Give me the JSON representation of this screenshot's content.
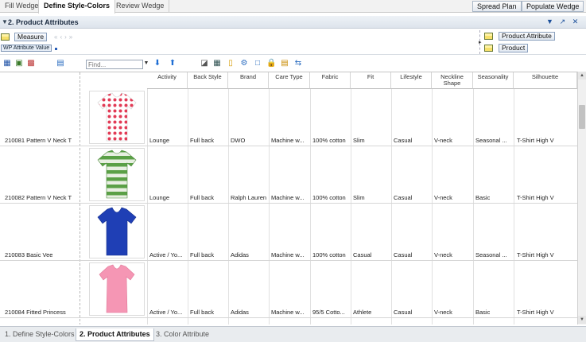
{
  "top_tabs": [
    "Fill Wedge",
    "Define Style-Colors",
    "Review Wedge"
  ],
  "top_buttons": {
    "spread_plan": "Spread Plan",
    "populate_wedge": "Populate Wedge"
  },
  "section": {
    "title": "2. Product Attributes"
  },
  "pivot": {
    "measure": "Measure",
    "wp_attribute": "WP Attribute Value",
    "product_attribute": "Product Attribute",
    "product": "Product"
  },
  "toolbar": {
    "find_placeholder": "Find..."
  },
  "columns": [
    "Activity",
    "Back Style",
    "Brand",
    "Care Type",
    "Fabric",
    "Fit",
    "Lifestyle",
    "Neckline Shape",
    "Seasonality",
    "Silhouette"
  ],
  "rows": [
    {
      "label": "210081 Pattern V Neck T",
      "values": [
        "Lounge",
        "Full back",
        "DWO",
        "Machine w...",
        "100% cotton",
        "Slim",
        "Casual",
        "V-neck",
        "Seasonal ...",
        "T-Shirt High V"
      ]
    },
    {
      "label": "210082 Pattern V Neck T",
      "values": [
        "Lounge",
        "Full back",
        "Ralph Lauren",
        "Machine w...",
        "100% cotton",
        "Slim",
        "Casual",
        "V-neck",
        "Basic",
        "T-Shirt High V"
      ]
    },
    {
      "label": "210083 Basic Vee",
      "values": [
        "Active / Yo...",
        "Full back",
        "Adidas",
        "Machine w...",
        "100% cotton",
        "Casual",
        "Casual",
        "V-neck",
        "Seasonal ...",
        "T-Shirt High V"
      ]
    },
    {
      "label": "210084 Fitted Princess",
      "values": [
        "Active / Yo...",
        "Full back",
        "Adidas",
        "Machine w...",
        "95/5 Cotto...",
        "Athlete",
        "Casual",
        "V-neck",
        "Basic",
        "T-Shirt High V"
      ]
    }
  ],
  "bottom_tabs": [
    "1. Define Style-Colors",
    "2. Product Attributes",
    "3. Color Attribute"
  ],
  "colors": {
    "accent": "#1a4e9a",
    "header_bg": "#dde4ec",
    "tab_bg": "#f2f2f2"
  }
}
